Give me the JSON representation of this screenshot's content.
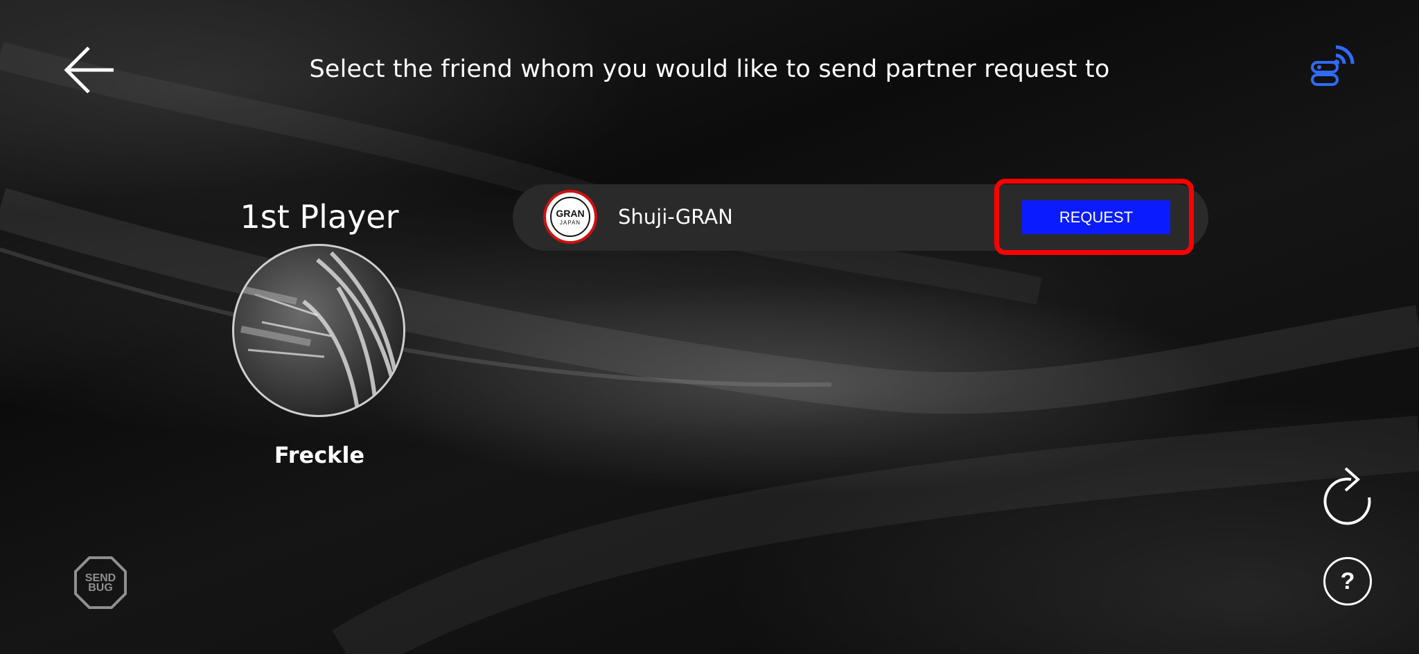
{
  "header": {
    "title": "Select the friend whom you would like to send partner request to",
    "back_icon": "arrow-left-icon",
    "connection_icon": "wifi-toggle-icon"
  },
  "player": {
    "label": "1st Player",
    "name": "Freckle",
    "avatar_icon": "dartboard-photo"
  },
  "friends": [
    {
      "name": "Shuji-GRAN",
      "avatar_text_main": "GRAN",
      "avatar_text_sub": "JAPAN",
      "action_label": "REQUEST"
    }
  ],
  "footer": {
    "send_bug_line1": "SEND",
    "send_bug_line2": "BUG",
    "refresh_icon": "refresh-icon",
    "help_label": "?"
  },
  "colors": {
    "request_button": "#0a1cff",
    "highlight_border": "#ff0000",
    "connection_icon": "#2f6bff"
  }
}
